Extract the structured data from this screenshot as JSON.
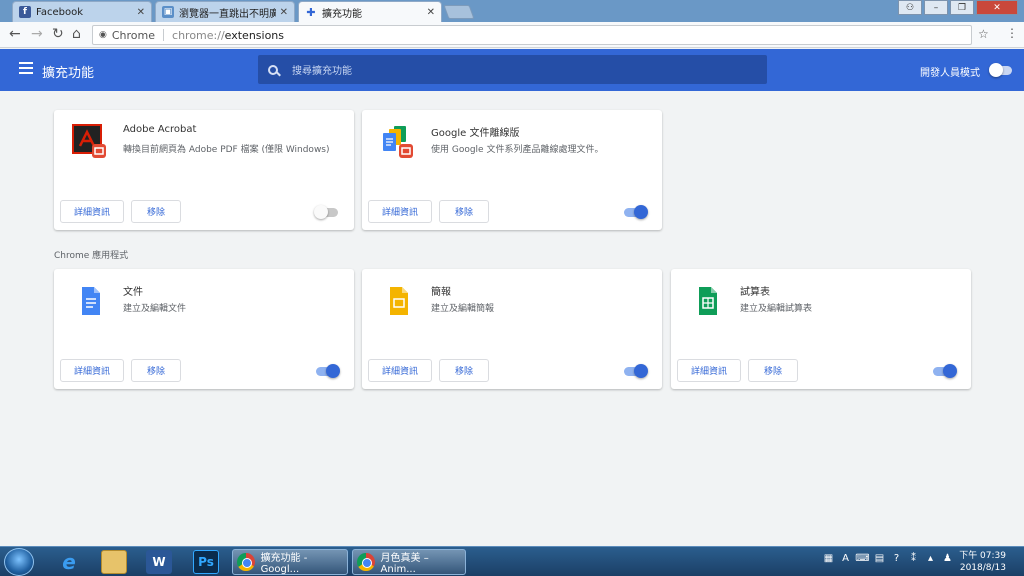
{
  "browser": {
    "tabs": [
      {
        "label": "Facebook",
        "icon": "facebook-icon"
      },
      {
        "label": "瀏覽器一直跳出不明廣告",
        "icon": "page-icon"
      },
      {
        "label": "擴充功能",
        "icon": "puzzle-icon"
      }
    ],
    "address": {
      "site_label": "Chrome",
      "scheme": "chrome://",
      "path": "extensions"
    }
  },
  "header": {
    "title": "擴充功能",
    "search_placeholder": "搜尋擴充功能",
    "dev_mode_label": "開發人員模式",
    "dev_mode_on": false
  },
  "extensions": [
    {
      "name": "Adobe Acrobat",
      "description": "轉換目前網頁為 Adobe PDF 檔案 (僅限 Windows)",
      "details_label": "詳細資訊",
      "remove_label": "移除",
      "enabled": false,
      "icon": "adobe-acrobat-icon"
    },
    {
      "name": "Google 文件離線版",
      "description": "使用 Google 文件系列產品離線處理文件。",
      "details_label": "詳細資訊",
      "remove_label": "移除",
      "enabled": true,
      "icon": "google-docs-offline-icon"
    }
  ],
  "apps_section": {
    "title": "Chrome 應用程式",
    "items": [
      {
        "name": "文件",
        "description": "建立及編輯文件",
        "details_label": "詳細資訊",
        "remove_label": "移除",
        "enabled": true,
        "icon": "google-docs-icon",
        "color": "#4285f4"
      },
      {
        "name": "簡報",
        "description": "建立及編輯簡報",
        "details_label": "詳細資訊",
        "remove_label": "移除",
        "enabled": true,
        "icon": "google-slides-icon",
        "color": "#f4b400"
      },
      {
        "name": "試算表",
        "description": "建立及編輯試算表",
        "details_label": "詳細資訊",
        "remove_label": "移除",
        "enabled": true,
        "icon": "google-sheets-icon",
        "color": "#0f9d58"
      }
    ]
  },
  "taskbar": {
    "apps": [
      {
        "label": "擴充功能 - Googl...",
        "icon": "chrome-icon"
      },
      {
        "label": "月色真美 – Anim...",
        "icon": "chrome-icon"
      }
    ],
    "clock": {
      "time": "下午 07:39",
      "date": "2018/8/13"
    },
    "tray_ime": "A"
  },
  "colors": {
    "accent": "#3367d6",
    "header_bg": "#3367d6",
    "search_bg": "#254ea7"
  }
}
